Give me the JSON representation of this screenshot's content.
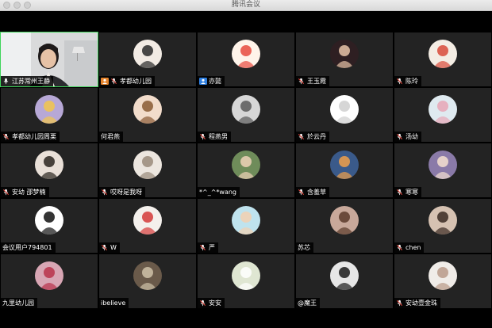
{
  "window": {
    "title": "腾讯会议"
  },
  "participants": [
    {
      "name": "江苏常州王静",
      "muted": false,
      "video": true,
      "badge": null,
      "avatar": {
        "bg": "#e8e8e8",
        "fg": "#333333"
      }
    },
    {
      "name": "孝都幼儿园",
      "muted": true,
      "badge": "orange",
      "avatar": {
        "bg": "#f2ebe4",
        "fg": "#2a2a2a"
      }
    },
    {
      "name": "亦懿",
      "muted": false,
      "badge": "blue",
      "avatar": {
        "bg": "#fff4ea",
        "fg": "#e84a3e"
      }
    },
    {
      "name": "王玉霞",
      "muted": true,
      "badge": null,
      "avatar": {
        "bg": "#2e1f22",
        "fg": "#e8c4a8"
      }
    },
    {
      "name": "陈玲",
      "muted": true,
      "badge": null,
      "avatar": {
        "bg": "#f4ede4",
        "fg": "#d84a3a"
      }
    },
    {
      "name": "孝都幼儿园周栗",
      "muted": true,
      "badge": null,
      "avatar": {
        "bg": "#b7a8d6",
        "fg": "#f2c64a"
      }
    },
    {
      "name": "何君燕",
      "muted": false,
      "badge": null,
      "avatar": {
        "bg": "#f2dccb",
        "fg": "#8a5a34"
      }
    },
    {
      "name": "程燕男",
      "muted": true,
      "badge": null,
      "avatar": {
        "bg": "#d7d7d7",
        "fg": "#5a5a5a"
      }
    },
    {
      "name": "於云丹",
      "muted": true,
      "badge": null,
      "avatar": {
        "bg": "#ffffff",
        "fg": "#cfcfcf"
      }
    },
    {
      "name": "汤幼",
      "muted": true,
      "badge": null,
      "avatar": {
        "bg": "#dfeaf0",
        "fg": "#e7a6b6"
      }
    },
    {
      "name": "安幼 邵梦楠",
      "muted": true,
      "badge": null,
      "avatar": {
        "bg": "#e9e0d8",
        "fg": "#2a2520"
      }
    },
    {
      "name": "哎呀是我呀",
      "muted": true,
      "badge": null,
      "avatar": {
        "bg": "#ece6df",
        "fg": "#9a8a7a"
      }
    },
    {
      "name": "*^_^*wang",
      "muted": false,
      "badge": null,
      "avatar": {
        "bg": "#6f8c5a",
        "fg": "#f0d2b8"
      }
    },
    {
      "name": "含羞草",
      "muted": true,
      "badge": null,
      "avatar": {
        "bg": "#3a5a8a",
        "fg": "#f0a04a"
      }
    },
    {
      "name": "寒寒",
      "muted": true,
      "badge": null,
      "avatar": {
        "bg": "#8a7aa8",
        "fg": "#f4e0d0"
      }
    },
    {
      "name": "会议用户794801",
      "muted": false,
      "badge": null,
      "avatar": {
        "bg": "#ffffff",
        "fg": "#111111"
      }
    },
    {
      "name": "W",
      "muted": true,
      "badge": null,
      "avatar": {
        "bg": "#f4f0ec",
        "fg": "#d43a3a"
      }
    },
    {
      "name": "严",
      "muted": true,
      "badge": null,
      "avatar": {
        "bg": "#bfe3ee",
        "fg": "#f2d0b0"
      }
    },
    {
      "name": "苏芯",
      "muted": false,
      "badge": null,
      "avatar": {
        "bg": "#c8a89a",
        "fg": "#5a3a2a"
      }
    },
    {
      "name": "chen",
      "muted": true,
      "badge": null,
      "avatar": {
        "bg": "#d6c2b2",
        "fg": "#3a2a22"
      }
    },
    {
      "name": "九里幼儿园",
      "muted": false,
      "badge": null,
      "avatar": {
        "bg": "#d8a6b4",
        "fg": "#b8324a"
      }
    },
    {
      "name": "ibelieve",
      "muted": false,
      "badge": null,
      "avatar": {
        "bg": "#6a5a4a",
        "fg": "#cfc2a8"
      }
    },
    {
      "name": "安安",
      "muted": true,
      "badge": null,
      "avatar": {
        "bg": "#dfe6d2",
        "fg": "#ffffff"
      }
    },
    {
      "name": "@魔王",
      "muted": false,
      "badge": null,
      "avatar": {
        "bg": "#e6e6e6",
        "fg": "#1a1a1a"
      }
    },
    {
      "name": "安幼壹金珠",
      "muted": true,
      "badge": null,
      "avatar": {
        "bg": "#f0ece8",
        "fg": "#b89a88"
      }
    }
  ]
}
